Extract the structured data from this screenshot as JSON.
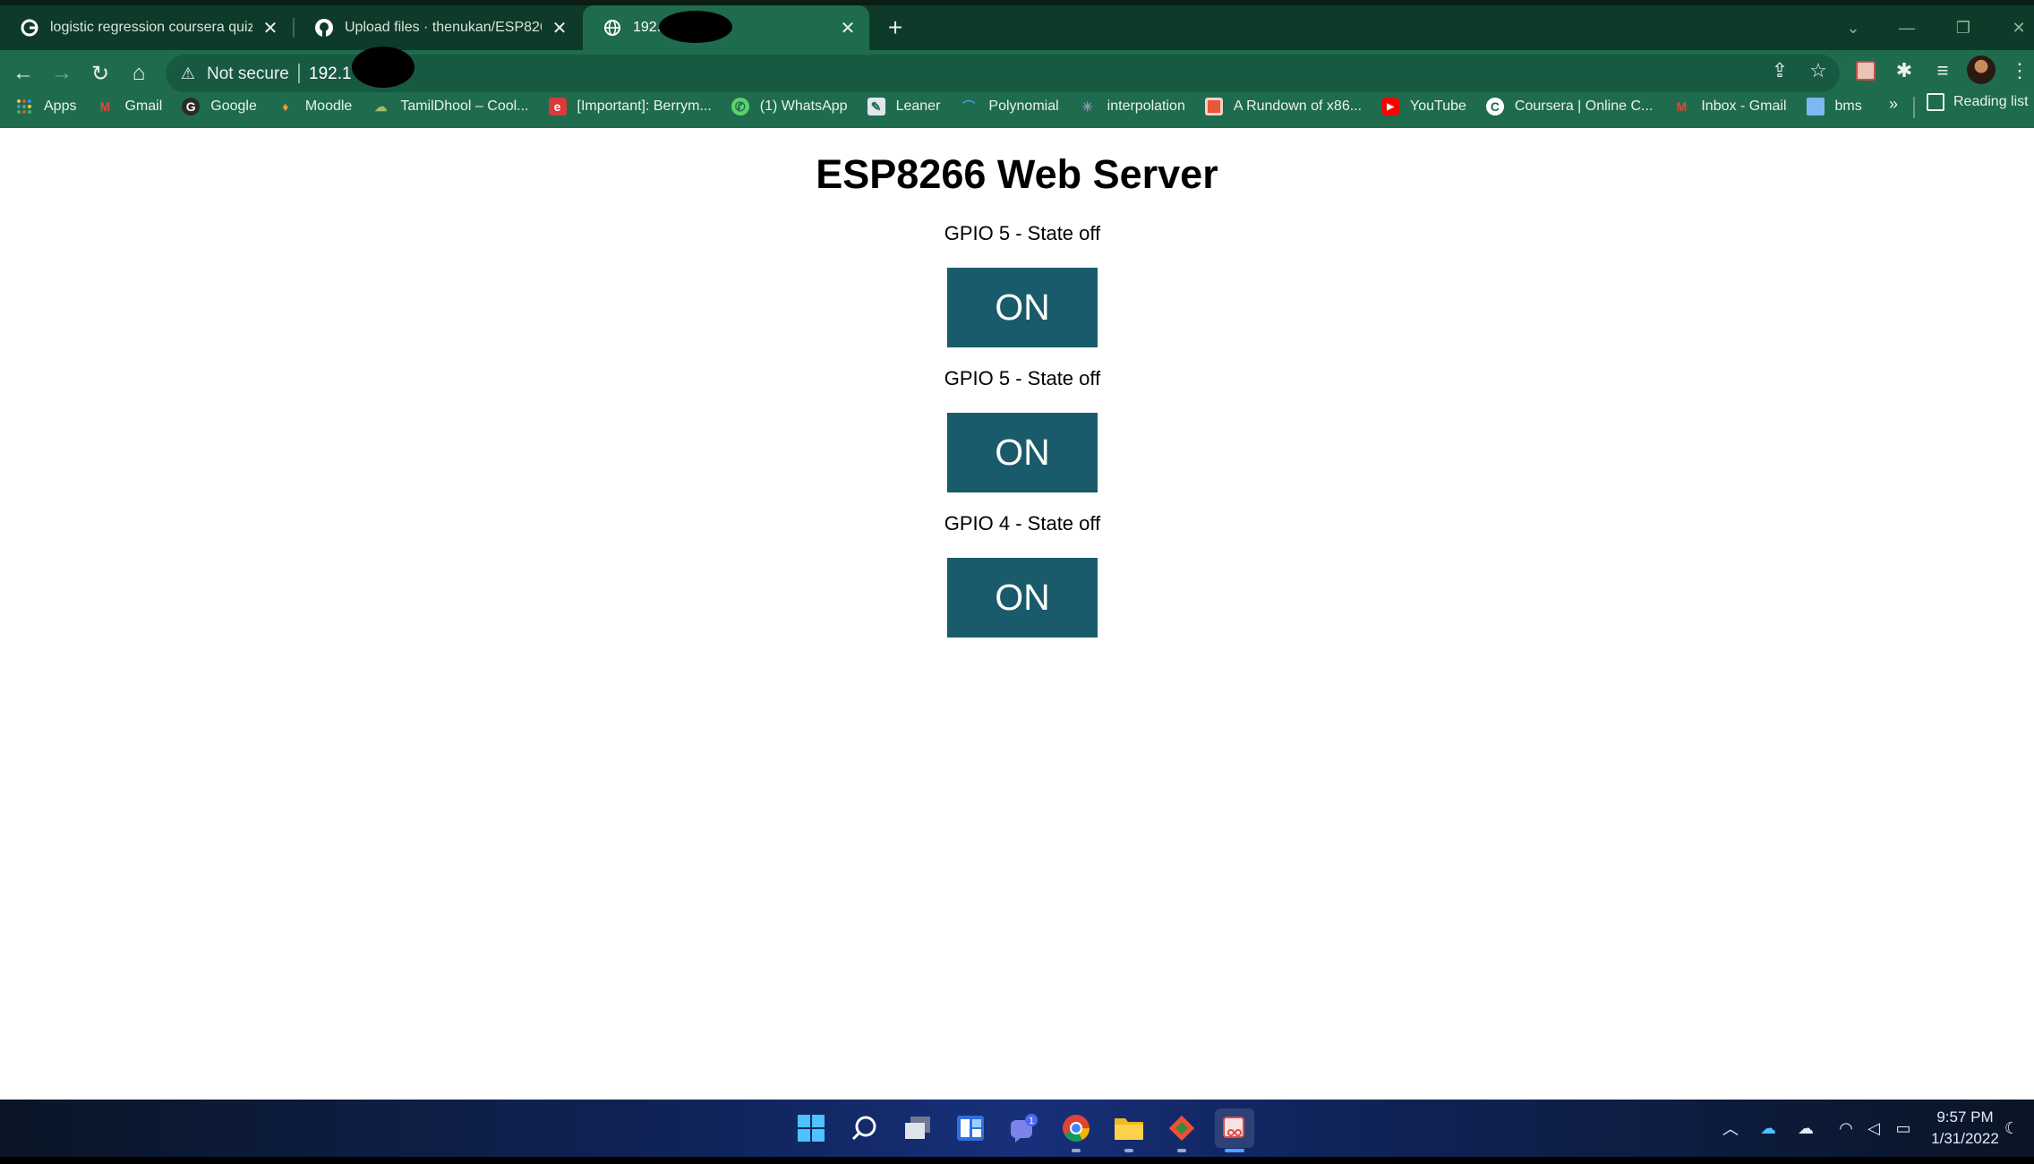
{
  "browser": {
    "tabs": [
      {
        "title": "logistic regression coursera quiz",
        "icon": "google-g-icon",
        "active": false
      },
      {
        "title": "Upload files · thenukan/ESP8266",
        "icon": "github-icon",
        "active": false
      },
      {
        "title": "192.1",
        "icon": "globe-icon",
        "active": true
      }
    ],
    "security_label": "Not secure",
    "url": "192.1",
    "bookmarks": [
      {
        "label": "Apps",
        "icon": "apps-grid-icon"
      },
      {
        "label": "Gmail",
        "icon": "gmail-icon"
      },
      {
        "label": "Google",
        "icon": "google-g-icon"
      },
      {
        "label": "Moodle",
        "icon": "moodle-icon"
      },
      {
        "label": "TamilDhool – Cool...",
        "icon": "tamildhool-icon"
      },
      {
        "label": "[Important]: Berrym...",
        "icon": "berrymail-icon"
      },
      {
        "label": "(1) WhatsApp",
        "icon": "whatsapp-icon"
      },
      {
        "label": "Leaner",
        "icon": "leaner-icon"
      },
      {
        "label": "Polynomial",
        "icon": "polynomial-icon"
      },
      {
        "label": "interpolation",
        "icon": "interpolation-icon"
      },
      {
        "label": "A Rundown of x86...",
        "icon": "rundown-icon"
      },
      {
        "label": "YouTube",
        "icon": "youtube-icon"
      },
      {
        "label": "Coursera | Online C...",
        "icon": "coursera-icon"
      },
      {
        "label": "Inbox - Gmail",
        "icon": "gmail-icon"
      },
      {
        "label": "bms",
        "icon": "folder-icon"
      }
    ],
    "more_bookmarks": "»",
    "reading_list": "Reading list"
  },
  "page": {
    "title": "ESP8266 Web Server",
    "controls": [
      {
        "label": "GPIO 5 - State off",
        "button": "ON"
      },
      {
        "label": "GPIO 5 - State off",
        "button": "ON"
      },
      {
        "label": "GPIO 4 - State off",
        "button": "ON"
      }
    ]
  },
  "taskbar": {
    "chat_badge": "1",
    "time": "9:57 PM",
    "date": "1/31/2022"
  },
  "colors": {
    "tabbar": "#0e3a29",
    "toolbar": "#1f6b4e",
    "button": "#195b6a",
    "page_background": "#ffffff"
  }
}
